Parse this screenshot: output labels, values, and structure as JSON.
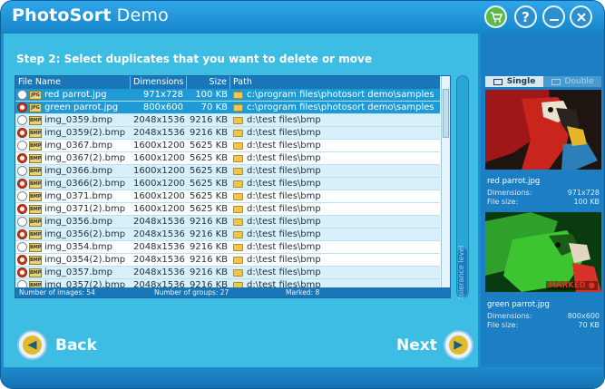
{
  "app": {
    "title": "PhotoSort",
    "subtitle": "Demo"
  },
  "titlebar_icons": [
    "cart-icon",
    "help-icon",
    "minimize-icon",
    "close-icon"
  ],
  "step_text": "Step 2:  Select duplicates that you want to delete or move",
  "grid": {
    "columns": [
      "File Name",
      "Dimensions",
      "Size",
      "Path"
    ],
    "rows": [
      {
        "name": "red parrot.jpg",
        "type": "JPG",
        "dim": "971x728",
        "size": "100 KB",
        "path": "c:\\program files\\photosort demo\\samples",
        "marked": false,
        "selected": true,
        "style": "sel"
      },
      {
        "name": "green parrot.jpg",
        "type": "JPG",
        "dim": "800x600",
        "size": "70 KB",
        "path": "c:\\program files\\photosort demo\\samples",
        "marked": true,
        "selected": true,
        "style": "sel"
      },
      {
        "name": "img_0359.bmp",
        "type": "BMP",
        "dim": "2048x1536",
        "size": "9216 KB",
        "path": "d:\\test files\\bmp",
        "marked": false,
        "style": "alt"
      },
      {
        "name": "img_0359(2).bmp",
        "type": "BMP",
        "dim": "2048x1536",
        "size": "9216 KB",
        "path": "d:\\test files\\bmp",
        "marked": true,
        "style": "alt"
      },
      {
        "name": "img_0367.bmp",
        "type": "BMP",
        "dim": "1600x1200",
        "size": "5625 KB",
        "path": "d:\\test files\\bmp",
        "marked": false,
        "style": "plain"
      },
      {
        "name": "img_0367(2).bmp",
        "type": "BMP",
        "dim": "1600x1200",
        "size": "5625 KB",
        "path": "d:\\test files\\bmp",
        "marked": true,
        "style": "plain"
      },
      {
        "name": "img_0366.bmp",
        "type": "BMP",
        "dim": "1600x1200",
        "size": "5625 KB",
        "path": "d:\\test files\\bmp",
        "marked": false,
        "style": "alt"
      },
      {
        "name": "img_0366(2).bmp",
        "type": "BMP",
        "dim": "1600x1200",
        "size": "5625 KB",
        "path": "d:\\test files\\bmp",
        "marked": true,
        "style": "alt"
      },
      {
        "name": "img_0371.bmp",
        "type": "BMP",
        "dim": "1600x1200",
        "size": "5625 KB",
        "path": "d:\\test files\\bmp",
        "marked": false,
        "style": "plain"
      },
      {
        "name": "img_0371(2).bmp",
        "type": "BMP",
        "dim": "1600x1200",
        "size": "5625 KB",
        "path": "d:\\test files\\bmp",
        "marked": true,
        "style": "plain"
      },
      {
        "name": "img_0356.bmp",
        "type": "BMP",
        "dim": "2048x1536",
        "size": "9216 KB",
        "path": "d:\\test files\\bmp",
        "marked": false,
        "style": "alt"
      },
      {
        "name": "img_0356(2).bmp",
        "type": "BMP",
        "dim": "2048x1536",
        "size": "9216 KB",
        "path": "d:\\test files\\bmp",
        "marked": true,
        "style": "alt"
      },
      {
        "name": "img_0354.bmp",
        "type": "BMP",
        "dim": "2048x1536",
        "size": "9216 KB",
        "path": "d:\\test files\\bmp",
        "marked": false,
        "style": "plain"
      },
      {
        "name": "img_0354(2).bmp",
        "type": "BMP",
        "dim": "2048x1536",
        "size": "9216 KB",
        "path": "d:\\test files\\bmp",
        "marked": true,
        "style": "plain"
      },
      {
        "name": "img_0357.bmp",
        "type": "BMP",
        "dim": "2048x1536",
        "size": "9216 KB",
        "path": "d:\\test files\\bmp",
        "marked": true,
        "style": "alt"
      },
      {
        "name": "img_0357(2).bmp",
        "type": "BMP",
        "dim": "2048x1536",
        "size": "9216 KB",
        "path": "d:\\test files\\bmp",
        "marked": false,
        "style": "alt"
      }
    ],
    "footer": {
      "images": "Number of images: 54",
      "groups": "Number of groups: 27",
      "marked": "Marked:  8"
    }
  },
  "tolerance": {
    "label": "tolerance level",
    "level": 0.22
  },
  "nav": {
    "back": "Back",
    "next": "Next"
  },
  "preview": {
    "view_single": "Single",
    "view_double": "Double",
    "image1": {
      "file": "red parrot.jpg",
      "dim_label": "Dimensions:",
      "dim": "971x728",
      "size_label": "File size:",
      "size": "100 KB"
    },
    "image2": {
      "file": "green parrot.jpg",
      "marked_label": "MARKED",
      "dim_label": "Dimensions:",
      "dim": "800x600",
      "size_label": "File size:",
      "size": "70 KB"
    }
  },
  "colors": {
    "accent": "#3dbde3",
    "header": "#1976b8",
    "selected_row": "#1e9ad6",
    "mark_red": "#d33a17"
  }
}
